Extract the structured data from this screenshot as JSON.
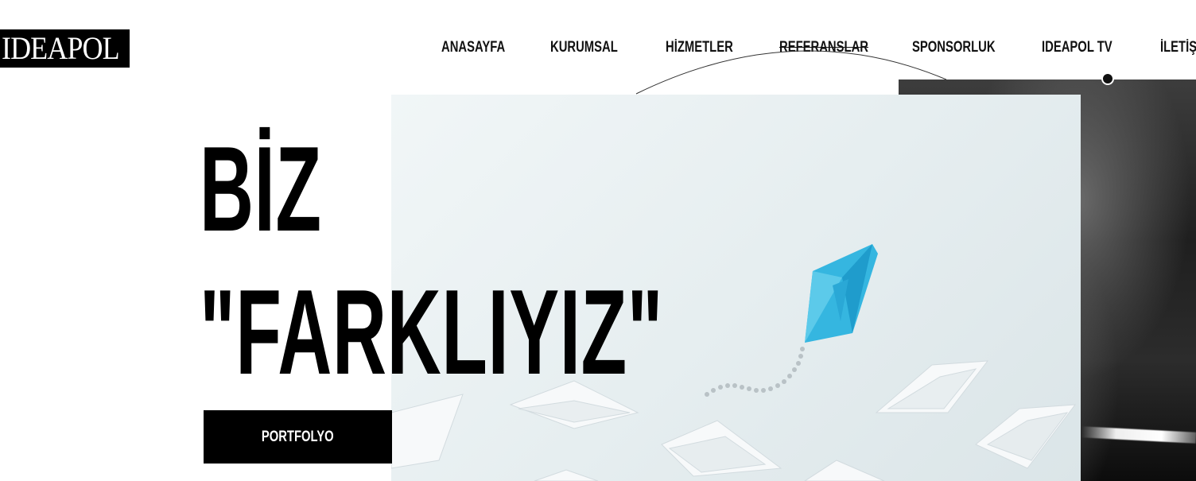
{
  "brand": {
    "logo_text": "IDEAPOL"
  },
  "nav": {
    "items": [
      {
        "label": "ANASAYFA"
      },
      {
        "label": "KURUMSAL"
      },
      {
        "label": "HİZMETLER"
      },
      {
        "label": "REFERANSLAR"
      },
      {
        "label": "SPONSORLUK"
      },
      {
        "label": "IDEAPOL TV"
      },
      {
        "label": "İLETİŞ"
      }
    ]
  },
  "hero": {
    "headline_line1": "BİZ",
    "headline_line2": "\"FARKLIYIZ\"",
    "cta_label": "PORTFOLYO"
  },
  "colors": {
    "text": "#000000",
    "button_bg": "#000000",
    "accent_boat": "#35b6e0"
  }
}
